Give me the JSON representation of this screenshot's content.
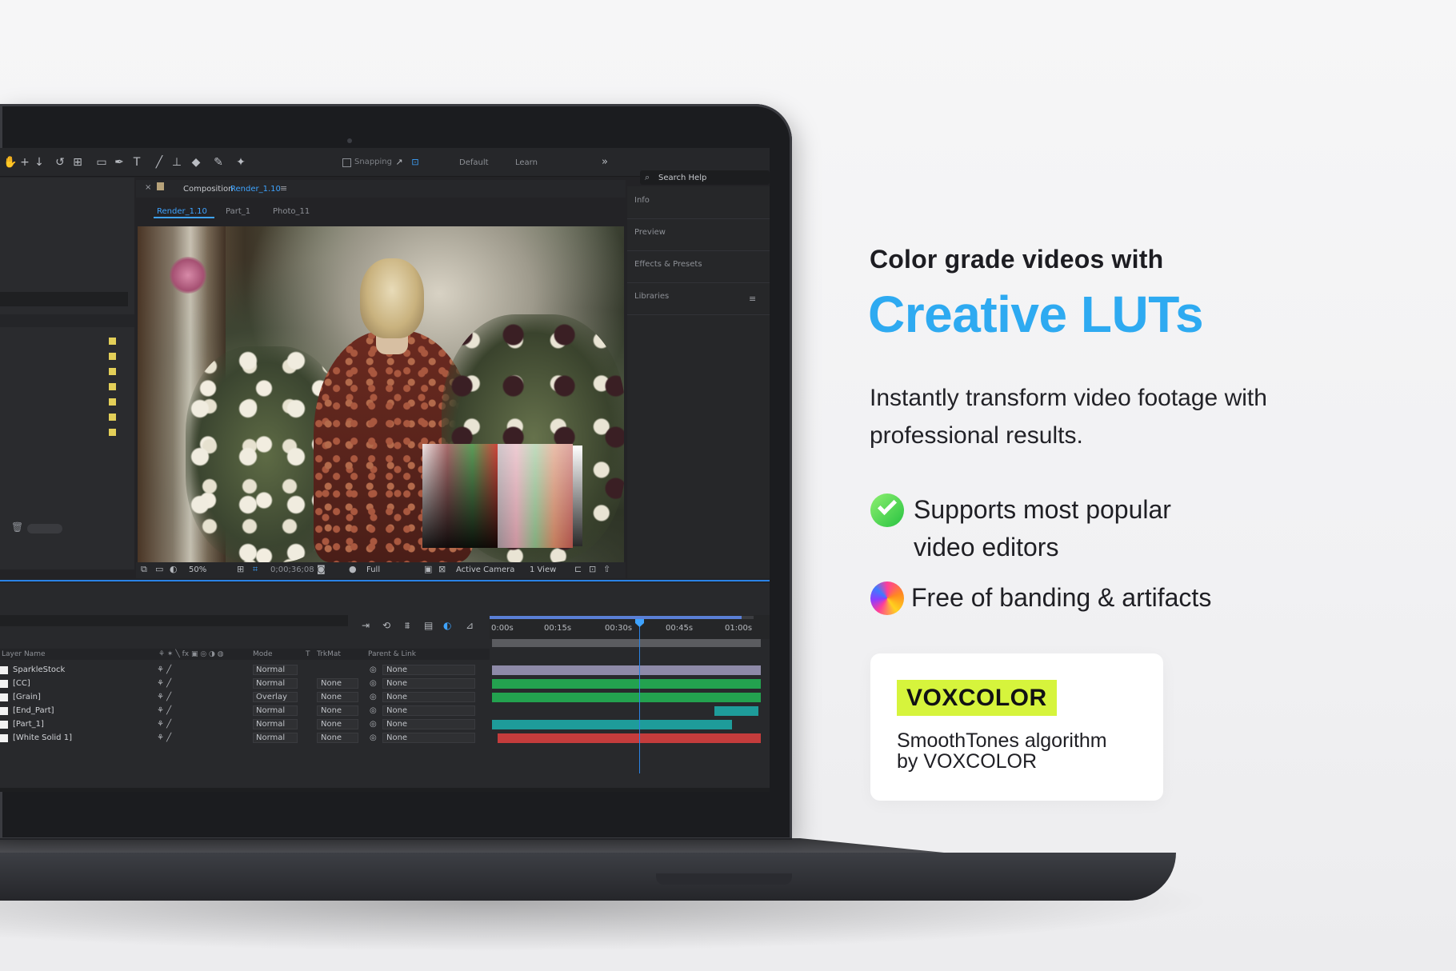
{
  "marketing": {
    "subtitle": "Color grade videos with",
    "title": "Creative LUTs",
    "description": "Instantly transform video footage with professional results.",
    "features": [
      {
        "icon": "check-circle-icon",
        "line1": "Supports most popular",
        "line2": "video editors"
      },
      {
        "icon": "spectrum-circle-icon",
        "line1": "Free of banding & artifacts"
      }
    ],
    "card": {
      "badge": "VOXCOLOR",
      "line1": "SmoothTones algorithm",
      "line2": "by VOXCOLOR"
    },
    "colors": {
      "title": "#2eaaf1",
      "badge": "#d6f43c",
      "check": "#27c241"
    }
  },
  "app": {
    "toolbar": {
      "snapping": "Snapping",
      "workspaces": [
        "Default",
        "Learn"
      ],
      "more": "»",
      "search_placeholder": "Search Help"
    },
    "composition": {
      "label": "Composition",
      "name": "Render_1.10",
      "crumbs": [
        "Render_1.10",
        "Part_1",
        "Photo_11"
      ]
    },
    "viewer_bar": {
      "zoom": "50%",
      "timecode": "0;00;36;08",
      "resolution": "Full",
      "camera": "Active Camera",
      "views": "1 View"
    },
    "right_panel": [
      "Info",
      "Preview",
      "Effects & Presets",
      "Libraries"
    ],
    "timeline": {
      "ticks": [
        "0:00s",
        "00:15s",
        "00:30s",
        "00:45s",
        "01:00s"
      ],
      "headers": {
        "layer": "Layer Name",
        "mode": "Mode",
        "t": "T",
        "trkmat": "TrkMat",
        "parent": "Parent & Link"
      },
      "layers": [
        {
          "name": "SparkleStock",
          "mode": "Normal",
          "trk": "",
          "parent": "None"
        },
        {
          "name": "[CC]",
          "mode": "Normal",
          "trk": "None",
          "parent": "None"
        },
        {
          "name": "[Grain]",
          "mode": "Overlay",
          "trk": "None",
          "parent": "None"
        },
        {
          "name": "[End_Part]",
          "mode": "Normal",
          "trk": "None",
          "parent": "None"
        },
        {
          "name": "[Part_1]",
          "mode": "Normal",
          "trk": "None",
          "parent": "None"
        },
        {
          "name": "[White Solid 1]",
          "mode": "Normal",
          "trk": "None",
          "parent": "None"
        }
      ],
      "track_colors": [
        "#8e8aa8",
        "#23a24f",
        "#23a24f",
        "#1e9c9a",
        "#1e9c9a",
        "#c43c3c"
      ]
    }
  }
}
